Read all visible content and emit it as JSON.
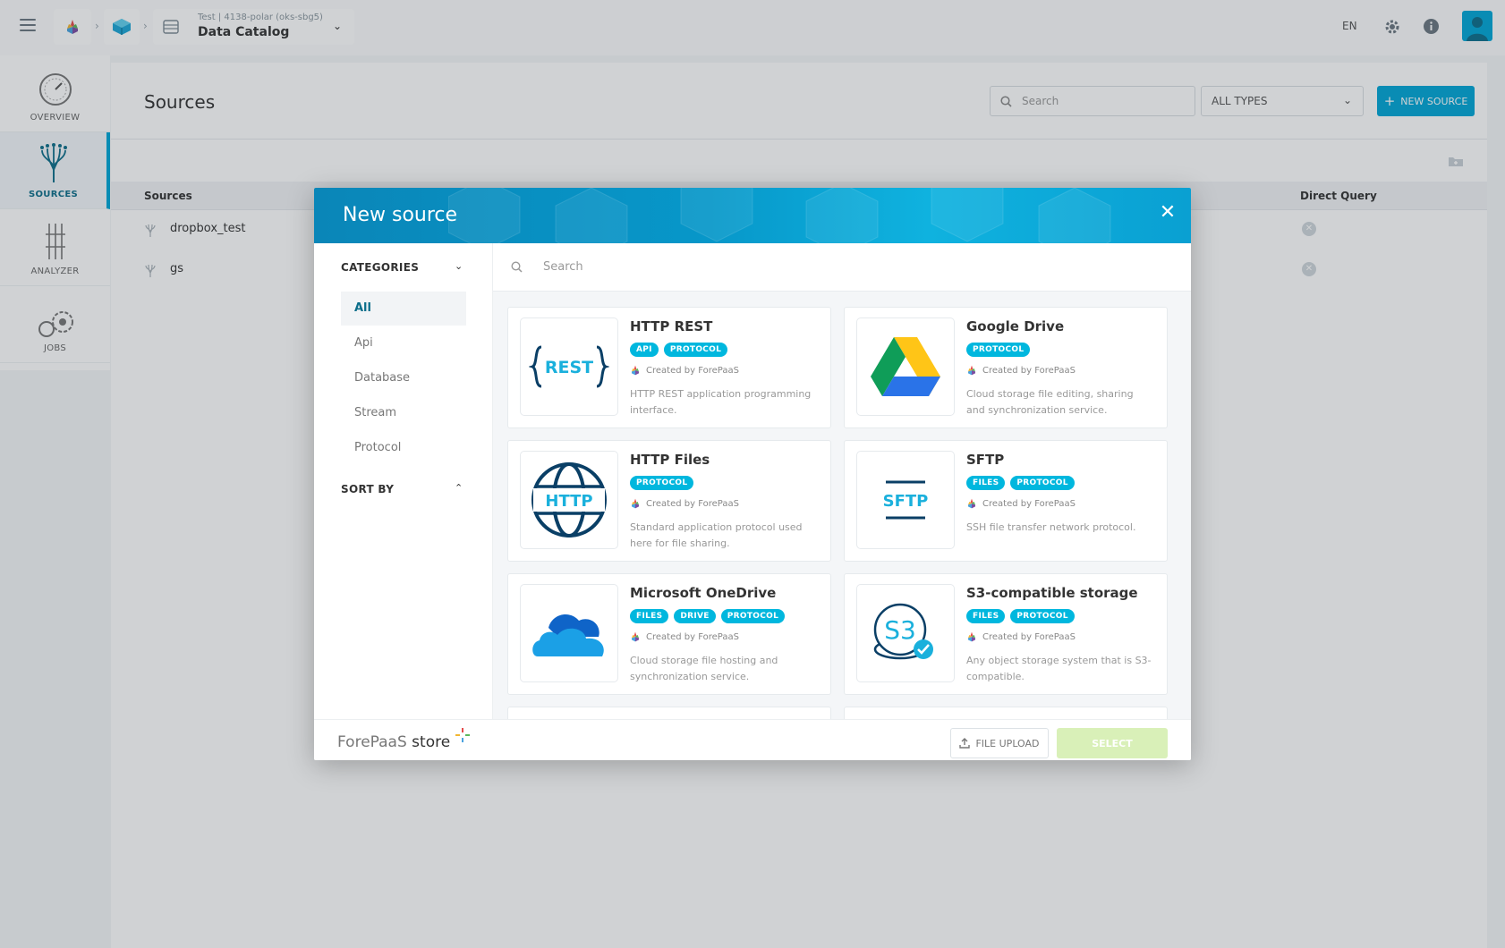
{
  "topbar": {
    "workspace_sub": "Test | 4138-polar (oks-sbg5)",
    "app_title": "Data Catalog",
    "lang": "EN"
  },
  "nav": [
    {
      "label": "OVERVIEW"
    },
    {
      "label": "SOURCES"
    },
    {
      "label": "ANALYZER"
    },
    {
      "label": "JOBS"
    }
  ],
  "page": {
    "title": "Sources",
    "search_placeholder": "Search",
    "type_filter": "ALL TYPES",
    "new_source_label": "NEW SOURCE",
    "table_headers": {
      "sources": "Sources",
      "direct_query": "Direct Query"
    },
    "rows": [
      {
        "name": "dropbox_test"
      },
      {
        "name": "gs"
      }
    ]
  },
  "modal": {
    "title": "New source",
    "search_placeholder": "Search",
    "categories_label": "CATEGORIES",
    "categories": [
      "All",
      "Api",
      "Database",
      "Stream",
      "Protocol"
    ],
    "selected_category": "All",
    "sort_by_label": "SORT BY",
    "cards": [
      {
        "title": "HTTP REST",
        "tags": [
          "API",
          "PROTOCOL"
        ],
        "by": "Created by ForePaaS",
        "desc": "HTTP REST application programming interface.",
        "logo_text": "REST"
      },
      {
        "title": "Google Drive",
        "tags": [
          "PROTOCOL"
        ],
        "by": "Created by ForePaaS",
        "desc": "Cloud storage file editing, sharing and synchronization service.",
        "logo_text": ""
      },
      {
        "title": "HTTP Files",
        "tags": [
          "PROTOCOL"
        ],
        "by": "Created by ForePaaS",
        "desc": "Standard application protocol used here for file sharing.",
        "logo_text": "HTTP"
      },
      {
        "title": "SFTP",
        "tags": [
          "FILES",
          "PROTOCOL"
        ],
        "by": "Created by ForePaaS",
        "desc": "SSH file transfer network protocol.",
        "logo_text": "SFTP"
      },
      {
        "title": "Microsoft OneDrive",
        "tags": [
          "FILES",
          "DRIVE",
          "PROTOCOL"
        ],
        "by": "Created by ForePaaS",
        "desc": "Cloud storage file hosting and synchronization service.",
        "logo_text": ""
      },
      {
        "title": "S3-compatible storage",
        "tags": [
          "FILES",
          "PROTOCOL"
        ],
        "by": "Created by ForePaaS",
        "desc": "Any object storage system that is S3-compatible.",
        "logo_text": "S3"
      }
    ],
    "footer": {
      "brand_a": "ForePaaS",
      "brand_b": "store",
      "file_upload_label": "FILE UPLOAD",
      "select_label": "SELECT"
    }
  },
  "colors": {
    "accent": "#00a6d6",
    "tag": "#00b7de",
    "select_disabled": "#d9f0b8"
  }
}
